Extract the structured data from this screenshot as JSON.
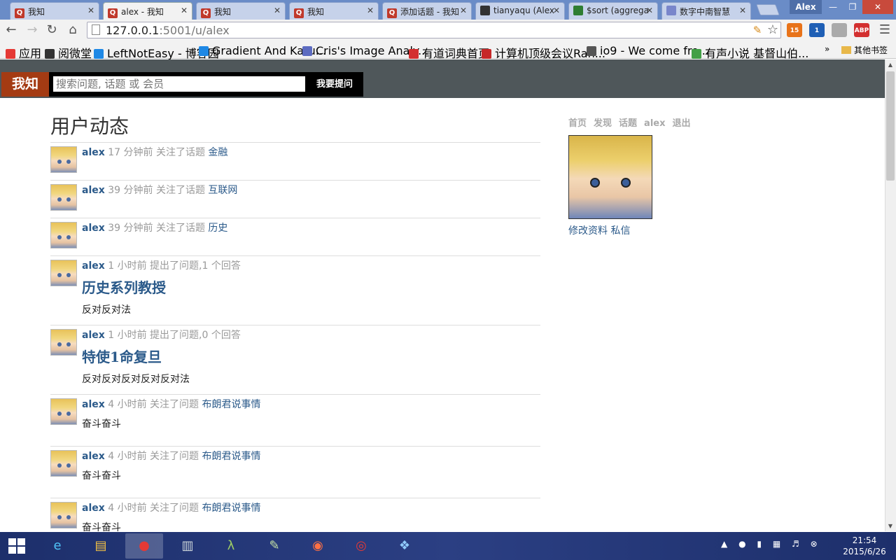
{
  "browser": {
    "tabs": [
      {
        "title": "我知",
        "favicon": "Q",
        "color": "#c0392b"
      },
      {
        "title": "alex - 我知",
        "favicon": "Q",
        "color": "#c0392b",
        "active": true
      },
      {
        "title": "我知",
        "favicon": "Q",
        "color": "#c0392b"
      },
      {
        "title": "我知",
        "favicon": "Q",
        "color": "#c0392b"
      },
      {
        "title": "添加话题 - 我知",
        "favicon": "Q",
        "color": "#c0392b"
      },
      {
        "title": "tianyaqu (Alex)",
        "favicon": "github-icon",
        "color": "#333333"
      },
      {
        "title": "$sort (aggregation)",
        "favicon": "leaf-icon",
        "color": "#2e7d32"
      },
      {
        "title": "数字中南智慧",
        "favicon": "image-icon",
        "color": "#7986cb"
      }
    ],
    "user_badge": "Alex",
    "address": {
      "host": "127.0.0.1",
      "rest": ":5001/u/alex"
    },
    "extensions": [
      {
        "name": "rss-icon",
        "badge": "15",
        "color": "#e8731a"
      },
      {
        "name": "stats-icon",
        "badge": "1",
        "color": "#1f5fb5"
      },
      {
        "name": "circle-icon",
        "badge": "",
        "color": "#aaaaaa"
      },
      {
        "name": "adblock-icon",
        "badge": "ABP",
        "color": "#d32f2f"
      }
    ],
    "bookmarks": [
      {
        "label": "应用",
        "icon": "apps-icon",
        "color": "#e53935"
      },
      {
        "label": "阅微堂",
        "icon": "zk-icon",
        "color": "#333333"
      },
      {
        "label": "LeftNotEasy - 博客园",
        "icon": "globe-icon",
        "color": "#1e88e5"
      },
      {
        "label": "Gradient And Karu...",
        "icon": "globe-icon",
        "color": "#1e88e5"
      },
      {
        "label": "Cris's Image Analy...",
        "icon": "c-icon",
        "color": "#5c6bc0"
      },
      {
        "label": "有道词典首页",
        "icon": "youdao-icon",
        "color": "#d32f2f"
      },
      {
        "label": "计算机顶级会议Ran...",
        "icon": "c-icon",
        "color": "#c62828"
      },
      {
        "label": "io9 - We come fro...",
        "icon": "io9-icon",
        "color": "#555555"
      },
      {
        "label": "有声小说 基督山伯...",
        "icon": "ping-icon",
        "color": "#43a047"
      }
    ],
    "bookmarks_more": "»",
    "bookmarks_other": "其他书签"
  },
  "site": {
    "logo": "我知",
    "search_placeholder": "搜索问题, 话题 或 会员",
    "ask_label": "我要提问"
  },
  "main": {
    "title": "用户动态",
    "feed": [
      {
        "user": "alex",
        "time": "17 分钟前",
        "action": "关注了话题",
        "target": "金融",
        "question": "",
        "answer": ""
      },
      {
        "user": "alex",
        "time": "39 分钟前",
        "action": "关注了话题",
        "target": "互联网",
        "question": "",
        "answer": ""
      },
      {
        "user": "alex",
        "time": "39 分钟前",
        "action": "关注了话题",
        "target": "历史",
        "question": "",
        "answer": ""
      },
      {
        "user": "alex",
        "time": "1 小时前",
        "action": "提出了问题,1 个回答",
        "target": "",
        "question": "历史系列教授",
        "answer": "反对反对法"
      },
      {
        "user": "alex",
        "time": "1 小时前",
        "action": "提出了问题,0 个回答",
        "target": "",
        "question": "特使1命复旦",
        "answer": "反对反对反对反对反对法"
      },
      {
        "user": "alex",
        "time": "4 小时前",
        "action": "关注了问题",
        "target": "布朗君说事情",
        "question": "",
        "answer": "奋斗奋斗"
      },
      {
        "user": "alex",
        "time": "4 小时前",
        "action": "关注了问题",
        "target": "布朗君说事情",
        "question": "",
        "answer": "奋斗奋斗"
      },
      {
        "user": "alex",
        "time": "4 小时前",
        "action": "关注了问题",
        "target": "布朗君说事情",
        "question": "",
        "answer": "奋斗奋斗"
      }
    ]
  },
  "sidebar": {
    "nav": [
      "首页",
      "发现",
      "话题",
      "alex",
      "退出"
    ],
    "edit_profile": "修改资料",
    "message": "私信"
  },
  "taskbar": {
    "apps": [
      "ie-icon",
      "explorer-icon",
      "chrome-icon",
      "reader-icon",
      "lambda-icon",
      "notepad-icon",
      "firefox-icon",
      "netease-music-icon",
      "paint-icon"
    ],
    "time": "21:54",
    "date": "2015/6/26"
  }
}
